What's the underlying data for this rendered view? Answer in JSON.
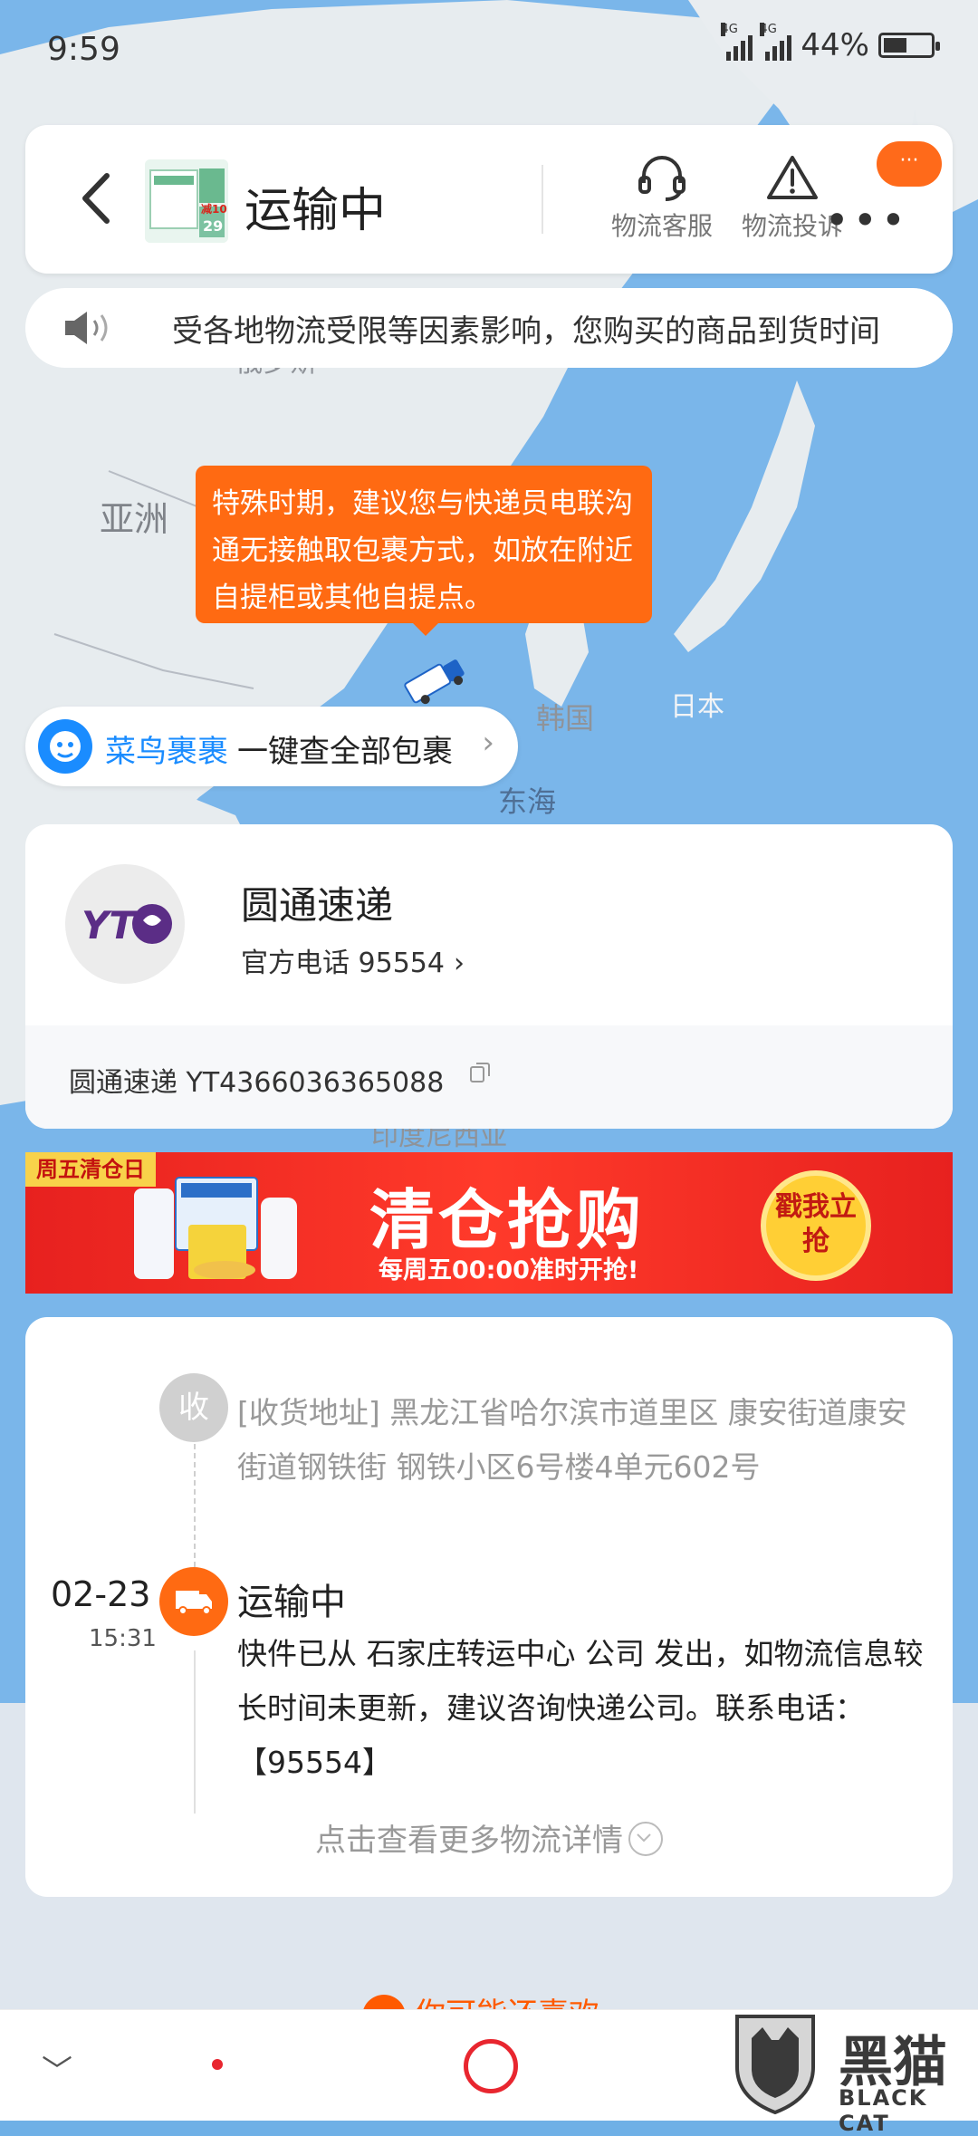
{
  "status_bar": {
    "time": "9:59",
    "network_tag_1": "4G",
    "network_tag_2": "4G",
    "battery": "44%",
    "battery_level": 0.44
  },
  "header": {
    "title": "运输中",
    "thumb_text_1": "29",
    "thumb_text_2": "减10",
    "service_label": "物流客服",
    "complaint_label": "物流投诉",
    "more_badge": "···",
    "more_dots": "•••"
  },
  "notice": {
    "text": "受各地物流受限等因素影响，您购买的商品到货时间"
  },
  "tooltip": {
    "text": "特殊时期，建议您与快递员电联沟通无接触取包裹方式，如放在附近自提柜或其他自提点。"
  },
  "map_labels": {
    "asia": "亚洲",
    "korea": "韩国",
    "japan": "日本",
    "east_sea": "东海",
    "russia": "俄罗斯",
    "indonesia": "印度尼西亚"
  },
  "cainiao": {
    "brand": "菜鸟裹裹",
    "action": "一键查全部包裹",
    "arrow": "›"
  },
  "courier": {
    "name": "圆通速递",
    "phone_label": "官方电话 95554",
    "logo_text": "YT",
    "tracking": "圆通速递 YT4366036365088"
  },
  "banner": {
    "flag": "周五清仓日",
    "headline": "清仓抢购",
    "subline": "每周五00:00准时开抢!",
    "cta": "戳我立抢"
  },
  "timeline": {
    "receive_icon": "收",
    "address": "[收货地址] 黑龙江省哈尔滨市道里区 康安街道康安街道钢铁街 钢铁小区6号楼4单元602号",
    "date": "02-23",
    "time": "15:31",
    "status": "运输中",
    "description": "快件已从 石家庄转运中心 公司 发出，如物流信息较长时间未更新，建议咨询快递公司。联系电话：【95554】",
    "more": "点击查看更多物流详情"
  },
  "bottom": {
    "peek_text": "你可能还喜欢",
    "chevron": "﹀"
  },
  "watermark": {
    "cn": "黑猫",
    "en": "BLACK CAT"
  }
}
